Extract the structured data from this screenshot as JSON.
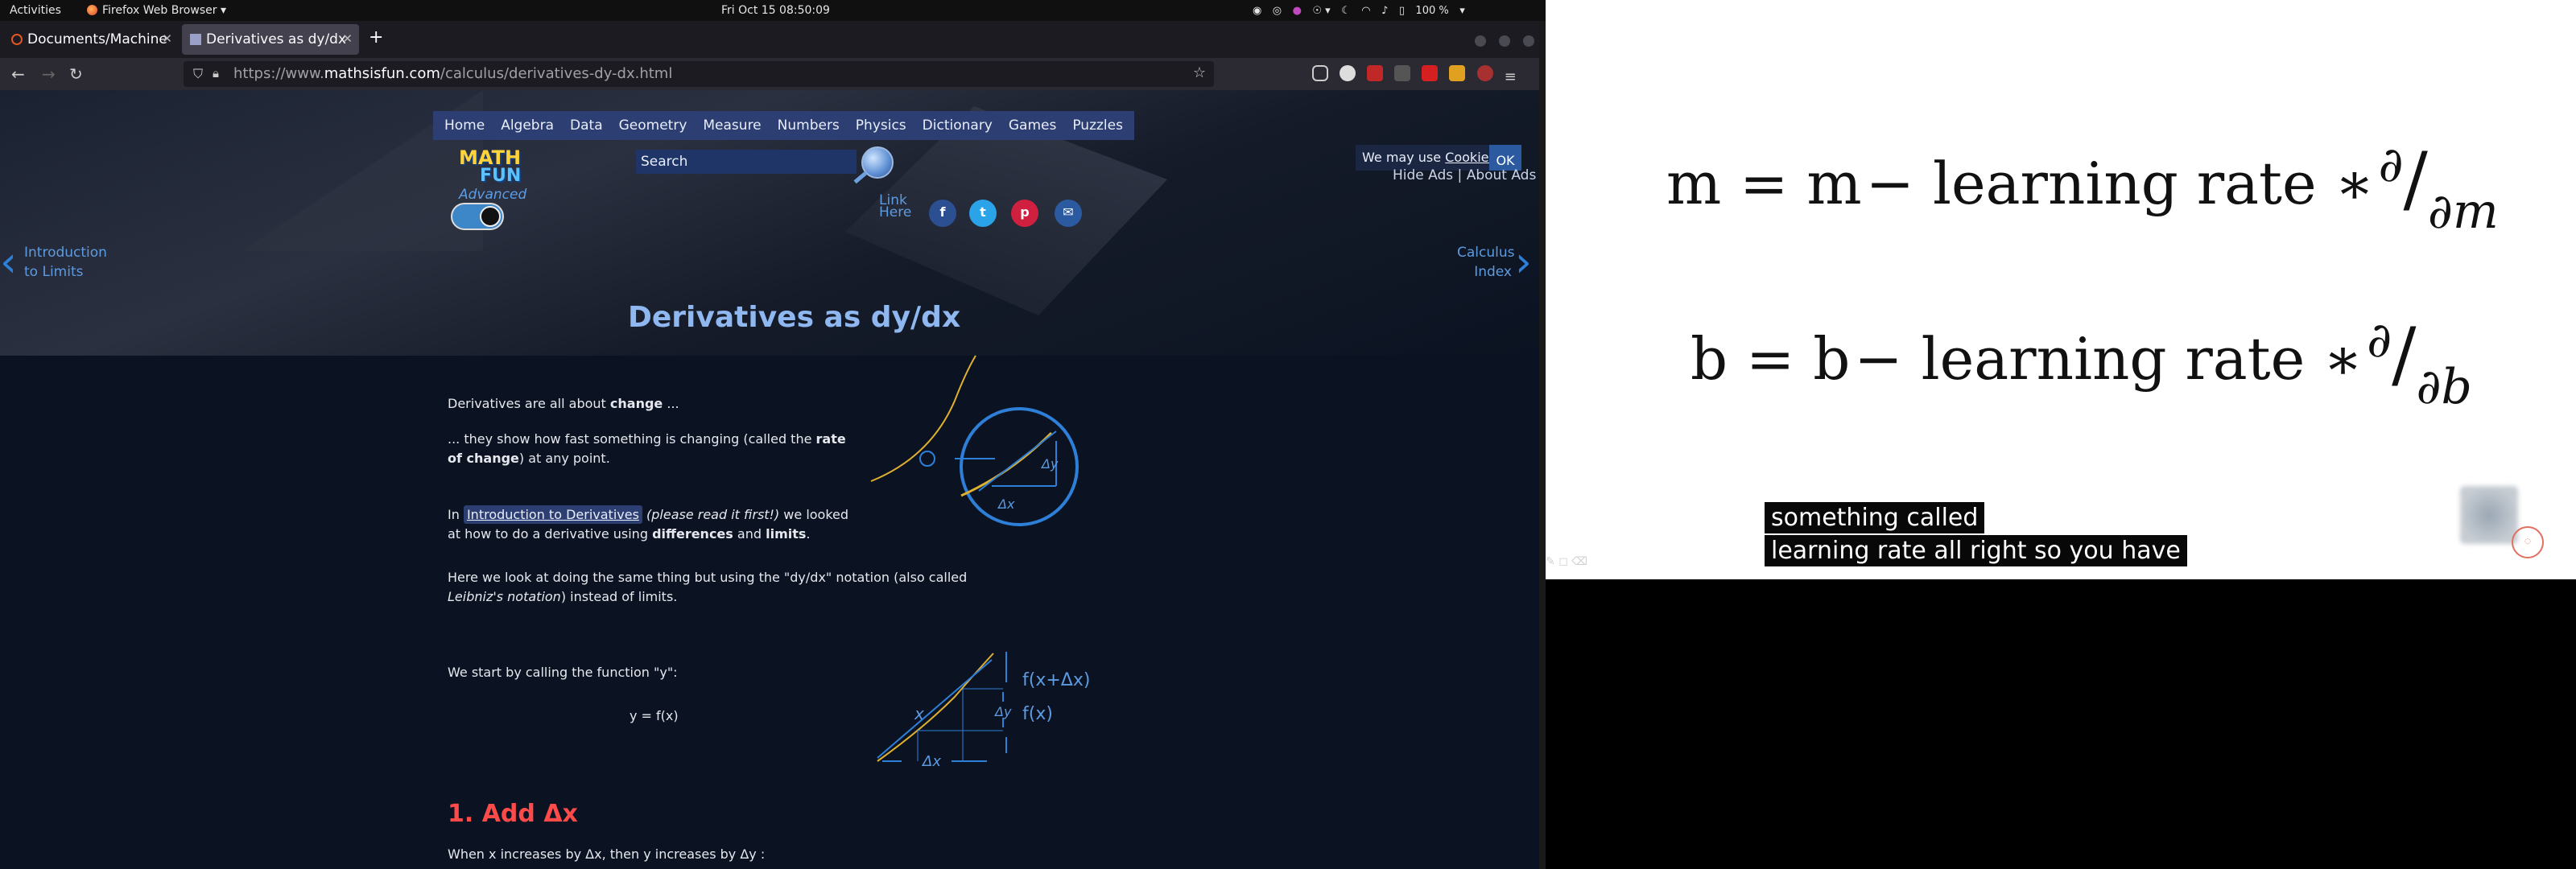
{
  "topbar": {
    "activities": "Activities",
    "app_name": "Firefox Web Browser",
    "clock": "Fri Oct 15  08:50:09",
    "battery": "100 %"
  },
  "browser": {
    "tabs": [
      {
        "label": "Documents/Machine",
        "active": false
      },
      {
        "label": "Derivatives as dy/dx",
        "active": true
      }
    ],
    "url_prefix": "https://www.",
    "url_domain": "mathsisfun.com",
    "url_path": "/calculus/derivatives-dy-dx.html"
  },
  "site": {
    "menu": [
      "Home",
      "Algebra",
      "Data",
      "Geometry",
      "Measure",
      "Numbers",
      "Physics",
      "Dictionary",
      "Games",
      "Puzzles"
    ],
    "logo_line1": "MATH",
    "logo_line2": "FUN",
    "logo_line3": "Advanced",
    "search_placeholder": "Search",
    "link_here_1": "Link",
    "link_here_2": "Here",
    "cookie_text": "We may use ",
    "cookie_link": "Cookies",
    "cookie_ok": "OK",
    "hide_ads": "Hide Ads",
    "about_ads": "About Ads",
    "prev_line1": "Introduction",
    "prev_line2": "to Limits",
    "next_line1": "Calculus",
    "next_line2": "Index",
    "title": "Derivatives as dy/dx",
    "p1_pre": "Derivatives are all about ",
    "p1_bold": "change",
    "p1_post": " ...",
    "p2_pre": "... they show how fast something is changing (called the ",
    "p2_bold1": "rate",
    "p2_bold2": "of change",
    "p2_post": ") at any point.",
    "p3_in": "In ",
    "p3_link": "Introduction to Derivatives",
    "p3_italic": "(please read it first!)",
    "p3_mid": " we looked",
    "p3_line2_pre": "at how to do a derivative using ",
    "p3_bold1": "differences",
    "p3_and": " and ",
    "p3_bold2": "limits",
    "p3_end": ".",
    "p4_line1": "Here we look at doing the same thing but using the \"dy/dx\" notation (also called",
    "p4_italic": "Leibniz's notation",
    "p4_post": ") instead of limits.",
    "p5": "We start by calling the function \"y\":",
    "formula": "y = f(x)",
    "heading_add": "1. Add Δx",
    "p6": "When x increases by Δx, then y increases by Δy :",
    "diagram1_dy": "Δy",
    "diagram1_dx": "Δx",
    "diagram2_x": "x",
    "diagram2_fxdx": "f(x+Δx)",
    "diagram2_dy": "Δy",
    "diagram2_fx": "f(x)",
    "diagram2_dx": "Δx"
  },
  "video": {
    "eq1_lhs": "m = m",
    "eq1_rhs": "− learning rate  ∗",
    "eq1_num": "∂",
    "eq1_den": "∂m",
    "eq2_lhs": "b = b",
    "eq2_rhs": "− learning rate  ∗",
    "eq2_num": "∂",
    "eq2_den": "∂b",
    "caption_line1": "something called",
    "caption_line2": "learning rate all right so you have"
  }
}
